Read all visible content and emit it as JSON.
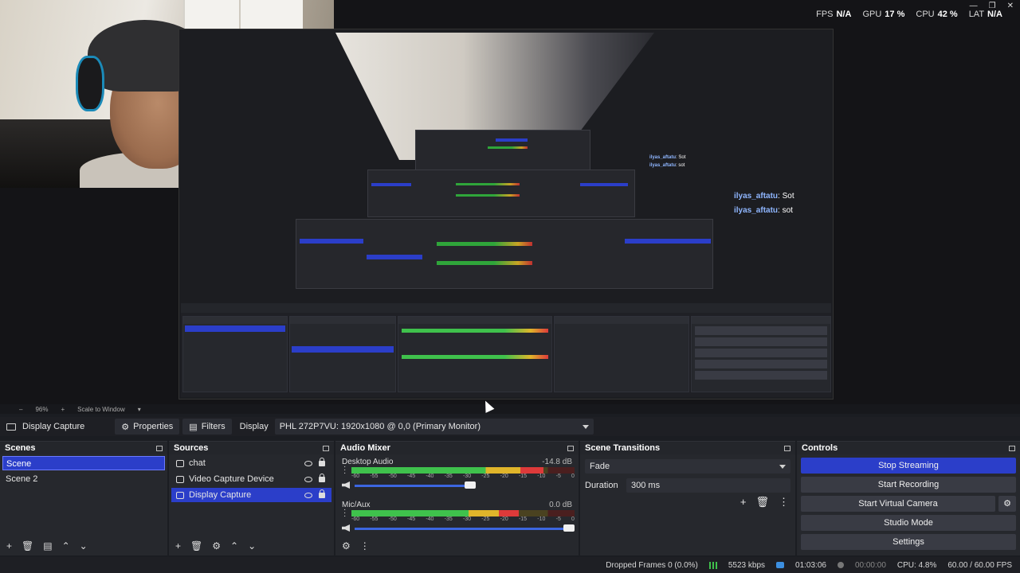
{
  "hud": {
    "fps_label": "FPS",
    "fps": "N/A",
    "gpu_label": "GPU",
    "gpu": "17 %",
    "cpu_label": "CPU",
    "cpu": "42 %",
    "lat_label": "LAT",
    "lat": "N/A"
  },
  "chat": [
    {
      "user": "ilyas_aftatu",
      "msg": ": Sot"
    },
    {
      "user": "ilyas_aftatu",
      "msg": ": sot"
    }
  ],
  "zoom": {
    "level": "96%",
    "fit": "Scale to Window"
  },
  "source_toolbar": {
    "source_name": "Display Capture",
    "properties_label": "Properties",
    "filters_label": "Filters",
    "display_label": "Display",
    "display_value": "PHL 272P7VU: 1920x1080 @ 0,0 (Primary Monitor)"
  },
  "scenes": {
    "title": "Scenes",
    "items": [
      {
        "label": "Scene",
        "selected": true
      },
      {
        "label": "Scene 2",
        "selected": false
      }
    ]
  },
  "sources": {
    "title": "Sources",
    "items": [
      {
        "label": "chat",
        "selected": false
      },
      {
        "label": "Video Capture Device",
        "selected": false
      },
      {
        "label": "Display Capture",
        "selected": true
      }
    ]
  },
  "mixer": {
    "title": "Audio Mixer",
    "channels": [
      {
        "name": "Desktop Audio",
        "db": "-14.8 dB",
        "level": 0.86,
        "volume": 0.55
      },
      {
        "name": "Mic/Aux",
        "db": "0.0 dB",
        "level": 0.75,
        "volume": 1.0
      }
    ],
    "ticks": [
      "-60",
      "-55",
      "-50",
      "-45",
      "-40",
      "-35",
      "-30",
      "-25",
      "-20",
      "-15",
      "-10",
      "-5",
      "0"
    ]
  },
  "transitions": {
    "title": "Scene Transitions",
    "type": "Fade",
    "duration_label": "Duration",
    "duration": "300 ms"
  },
  "controls": {
    "title": "Controls",
    "stop_streaming": "Stop Streaming",
    "start_recording": "Start Recording",
    "start_virtual_camera": "Start Virtual Camera",
    "studio_mode": "Studio Mode",
    "settings": "Settings"
  },
  "status": {
    "dropped": "Dropped Frames 0 (0.0%)",
    "bitrate": "5523 kbps",
    "stream_time": "01:03:06",
    "rec_time": "00:00:00",
    "cpu": "CPU: 4.8%",
    "fps": "60.00 / 60.00 FPS"
  },
  "colors": {
    "accent": "#2b3ec9",
    "panel": "#26282d",
    "meter_green": "#3fc14c",
    "meter_yellow": "#e0b52a",
    "meter_red": "#dd3a3a"
  }
}
